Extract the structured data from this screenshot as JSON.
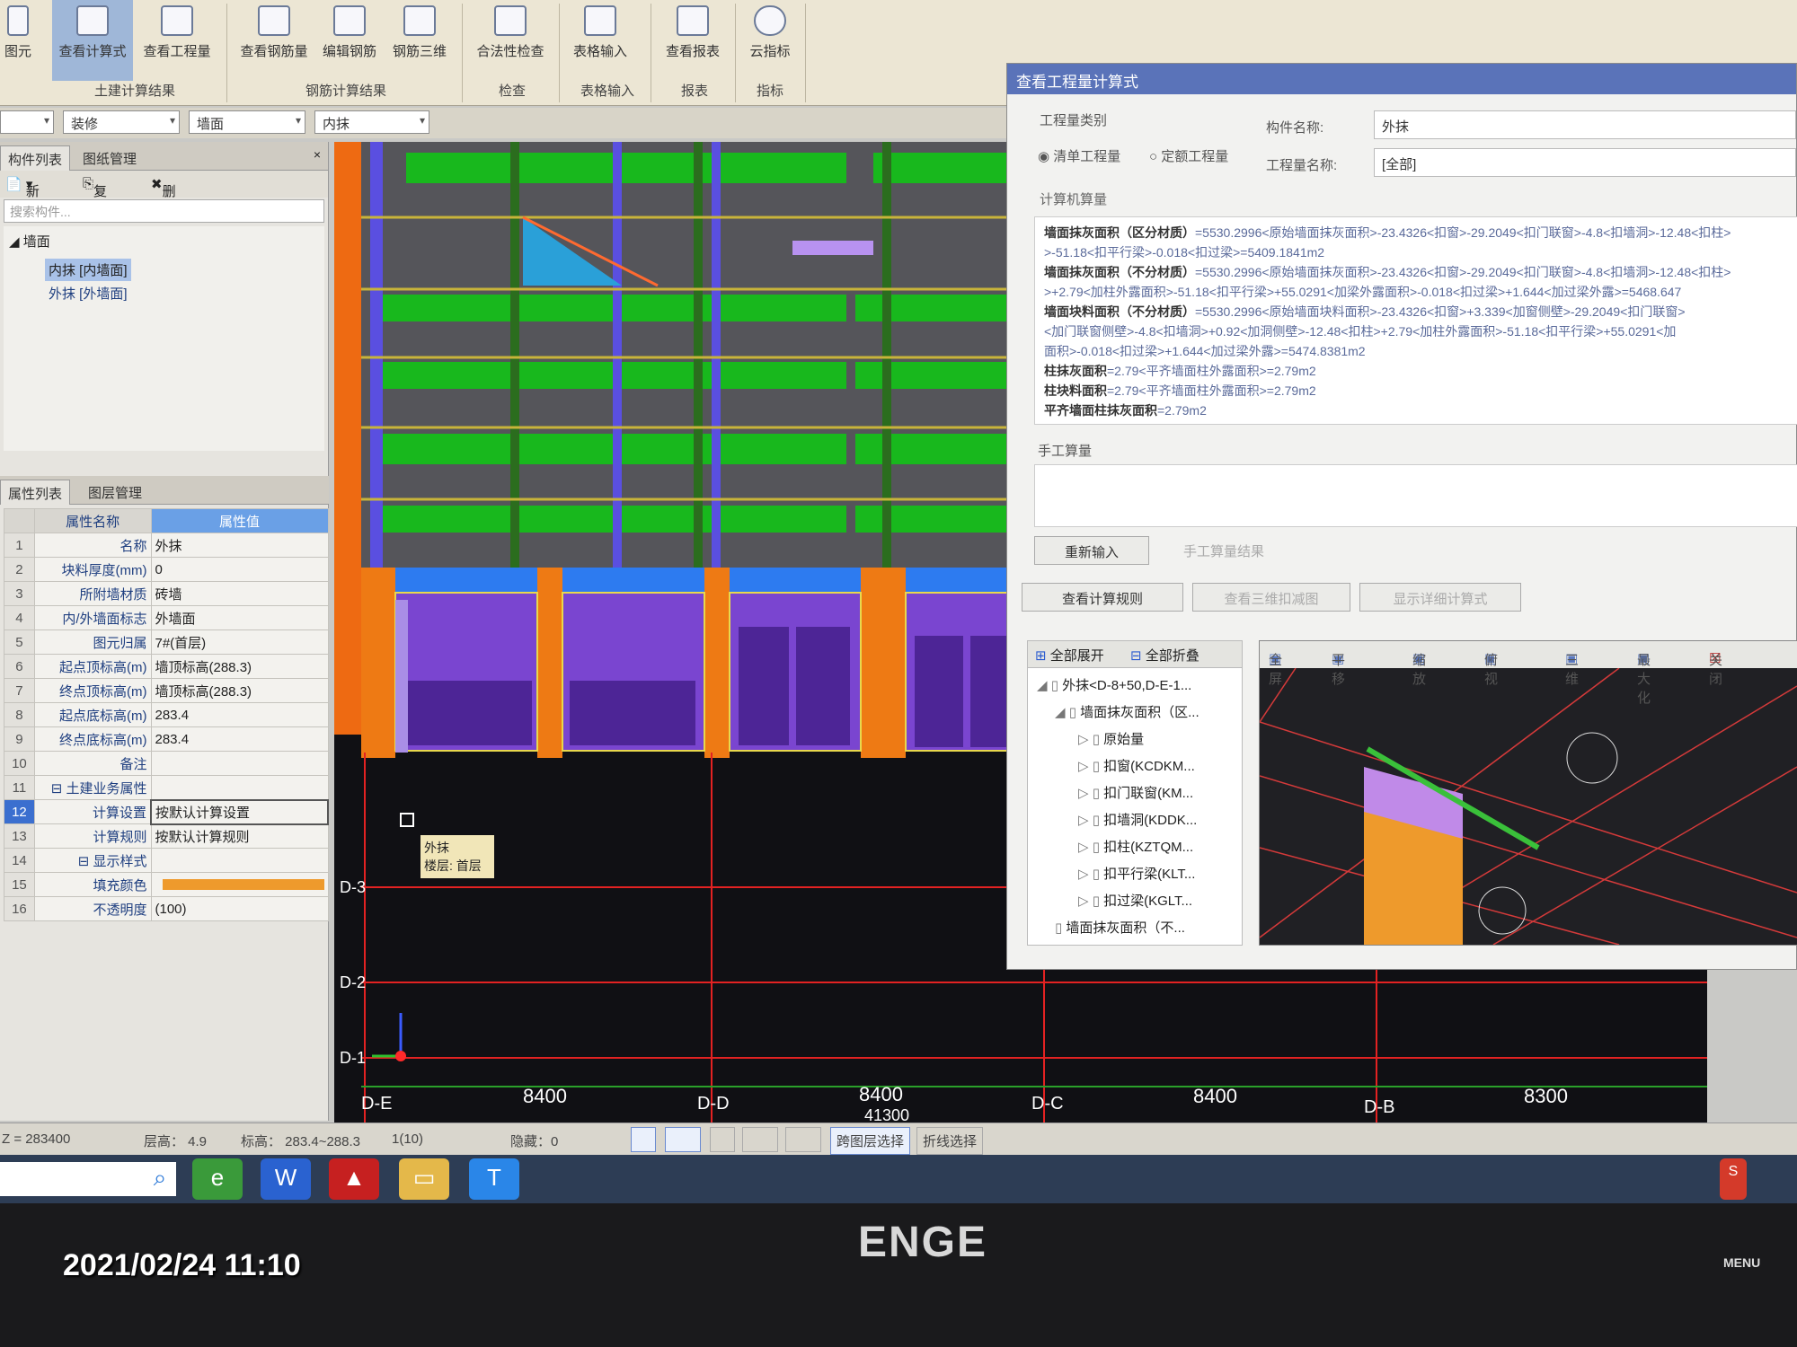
{
  "ribbon": {
    "buttons": [
      {
        "label": "图元"
      },
      {
        "label": "查看计算式"
      },
      {
        "label": "查看工程量"
      },
      {
        "label": "查看钢筋量"
      },
      {
        "label": "编辑钢筋"
      },
      {
        "label": "钢筋三维"
      },
      {
        "label": "合法性检查"
      },
      {
        "label": "表格输入"
      },
      {
        "label": "查看报表"
      },
      {
        "label": "云指标"
      }
    ],
    "groups": [
      "土建计算结果",
      "钢筋计算结果",
      "检查",
      "表格输入",
      "报表",
      "指标"
    ]
  },
  "combos": {
    "c2": "装修",
    "c3": "墙面",
    "c4": "内抹"
  },
  "component_panel": {
    "tabs": [
      "构件列表",
      "图纸管理"
    ],
    "tools": [
      "新建",
      "复制",
      "删除"
    ],
    "search_placeholder": "搜索构件...",
    "tree_root": "墙面",
    "tree_items": [
      "内抹 [内墙面]",
      "外抹 [外墙面]"
    ]
  },
  "property_panel": {
    "tabs": [
      "属性列表",
      "图层管理"
    ],
    "col_name": "属性名称",
    "col_value": "属性值",
    "rows": [
      {
        "num": "1",
        "name": "名称",
        "value": "外抹"
      },
      {
        "num": "2",
        "name": "块料厚度(mm)",
        "value": "0"
      },
      {
        "num": "3",
        "name": "所附墙材质",
        "value": "砖墙"
      },
      {
        "num": "4",
        "name": "内/外墙面标志",
        "value": "外墙面"
      },
      {
        "num": "5",
        "name": "图元归属",
        "value": "7#(首层)"
      },
      {
        "num": "6",
        "name": "起点顶标高(m)",
        "value": "墙顶标高(288.3)"
      },
      {
        "num": "7",
        "name": "终点顶标高(m)",
        "value": "墙顶标高(288.3)"
      },
      {
        "num": "8",
        "name": "起点底标高(m)",
        "value": "283.4"
      },
      {
        "num": "9",
        "name": "终点底标高(m)",
        "value": "283.4"
      },
      {
        "num": "10",
        "name": "备注",
        "value": ""
      },
      {
        "num": "11",
        "name": "⊟ 土建业务属性",
        "value": ""
      },
      {
        "num": "12",
        "name": "计算设置",
        "value": "按默认计算设置"
      },
      {
        "num": "13",
        "name": "计算规则",
        "value": "按默认计算规则"
      },
      {
        "num": "14",
        "name": "⊟ 显示样式",
        "value": ""
      },
      {
        "num": "15",
        "name": "填充颜色",
        "value": ""
      },
      {
        "num": "16",
        "name": "不透明度",
        "value": "(100)"
      }
    ],
    "fill_color": "#ee9a2c"
  },
  "cad": {
    "tooltip_line1": "外抹",
    "tooltip_line2": "楼层: 首层",
    "axis_rows": [
      "D-3",
      "D-2",
      "D-1"
    ],
    "axis_cols": [
      "D-E",
      "D-D",
      "D-C",
      "D-B"
    ],
    "dims": [
      "8400",
      "8400",
      "8400",
      "8300"
    ],
    "dim_total": "41300"
  },
  "dialog": {
    "title": "查看工程量计算式",
    "type_label": "工程量类别",
    "radio1": "清单工程量",
    "radio2": "定额工程量",
    "comp_name_label": "构件名称:",
    "comp_name_value": "外抹",
    "qty_name_label": "工程量名称:",
    "qty_name_value": "[全部]",
    "calc_label": "计算机算量",
    "calc_lines": [
      {
        "head": "墙面抹灰面积（区分材质）",
        "text": "=5530.2996<原始墙面抹灰面积>-23.4326<扣窗>-29.2049<扣门联窗>-4.8<扣墙洞>-12.48<扣柱>"
      },
      {
        "head": "",
        "text": ">-51.18<扣平行梁>-0.018<扣过梁>=5409.1841m2"
      },
      {
        "head": "墙面抹灰面积（不分材质）",
        "text": "=5530.2996<原始墙面抹灰面积>-23.4326<扣窗>-29.2049<扣门联窗>-4.8<扣墙洞>-12.48<扣柱>"
      },
      {
        "head": "",
        "text": ">+2.79<加柱外露面积>-51.18<扣平行梁>+55.0291<加梁外露面积>-0.018<扣过梁>+1.644<加过梁外露>=5468.647"
      },
      {
        "head": "墙面块料面积（不分材质）",
        "text": "=5530.2996<原始墙面块料面积>-23.4326<扣窗>+3.339<加窗侧壁>-29.2049<扣门联窗>"
      },
      {
        "head": "",
        "text": "<加门联窗侧壁>-4.8<扣墙洞>+0.92<加洞侧壁>-12.48<扣柱>+2.79<加柱外露面积>-51.18<扣平行梁>+55.0291<加"
      },
      {
        "head": "",
        "text": "面积>-0.018<扣过梁>+1.644<加过梁外露>=5474.8381m2"
      },
      {
        "head": "柱抹灰面积",
        "text": "=2.79<平齐墙面柱外露面积>=2.79m2"
      },
      {
        "head": "柱块料面积",
        "text": "=2.79<平齐墙面柱外露面积>=2.79m2"
      },
      {
        "head": "平齐墙面柱抹灰面积",
        "text": "=2.79m2"
      }
    ],
    "manual_label": "手工算量",
    "btn_reinput": "重新输入",
    "btn_manual_result": "手工算量结果",
    "btn_rules": "查看计算规则",
    "btn_3d": "查看三维扣减图",
    "btn_detail": "显示详细计算式",
    "expand_all": "全部展开",
    "collapse_all": "全部折叠",
    "tree": [
      "外抹<D-8+50,D-E-1...",
      "墙面抹灰面积（区...",
      "原始量",
      "扣窗(KCDKM...",
      "扣门联窗(KM...",
      "扣墙洞(KDDK...",
      "扣柱(KZTQM...",
      "扣平行梁(KLT...",
      "扣过梁(KGLT...",
      "墙面抹灰面积（不..."
    ],
    "preview_tools": [
      "全屏",
      "平移",
      "缩放",
      "俯视",
      "三维",
      "最大化",
      "关闭"
    ]
  },
  "status": {
    "z": "Z = 283400",
    "floor_height": "层高：  4.9",
    "elevation": "标高：  283.4~288.3",
    "count": "1(10)",
    "hidden": "隐藏：0",
    "btn_cross_layer": "跨图层选择",
    "btn_polyline": "折线选择"
  },
  "taskbar": {
    "apps": [
      "search-app",
      "browser-app",
      "wps-app",
      "pdf-app",
      "explorer-app",
      "text-app"
    ]
  },
  "monitor": {
    "brand": "ENGE",
    "menu": "MENU"
  },
  "photo_timestamp": "2021/02/24  11:10"
}
